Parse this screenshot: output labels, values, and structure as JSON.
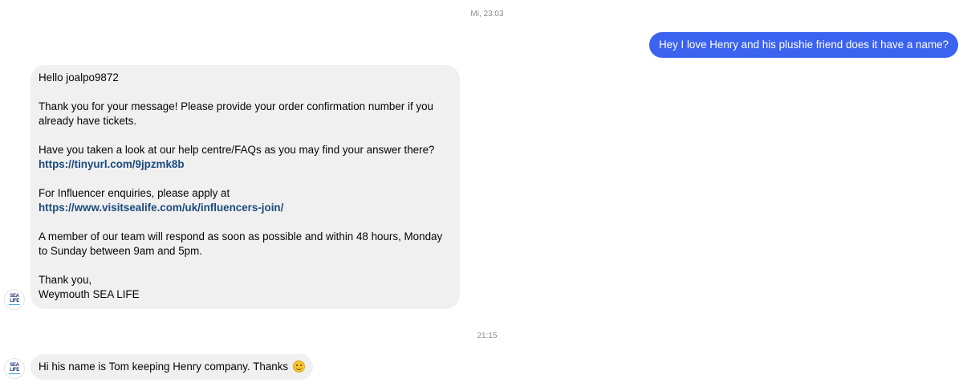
{
  "conversation": {
    "timestamps": {
      "first": "Mi, 23:03",
      "second": "21:15"
    },
    "outgoing": {
      "text": "Hey I love Henry and his plushie friend does it have a name?",
      "color": "#3b63f0"
    },
    "incoming_1": {
      "greeting": "Hello joalpo9872",
      "para1": "Thank you for your message! Please provide your order confirmation number if you already have tickets.",
      "para2": "Have you taken a look at our help centre/FAQs as you may find your answer there?",
      "link1": "https://tinyurl.com/9jpzmk8b",
      "para3": "For Influencer enquiries, please apply at",
      "link2": "https://www.visitsealife.com/uk/influencers-join/",
      "para4": "A member of our team will respond as soon as possible and within 48 hours, Monday to Sunday between 9am and 5pm.",
      "signoff1": "Thank you,",
      "signoff2": "Weymouth SEA LIFE"
    },
    "incoming_2": {
      "text": "Hi his name is Tom keeping Henry company. Thanks",
      "emoji": "smiling-face-emoji"
    },
    "sender": {
      "avatar_logo_text": "SEA LIFE",
      "brand_color": "#1d2f6f"
    },
    "bubble_colors": {
      "incoming": "#f0f0f0",
      "link": "#1c4a7e"
    }
  }
}
